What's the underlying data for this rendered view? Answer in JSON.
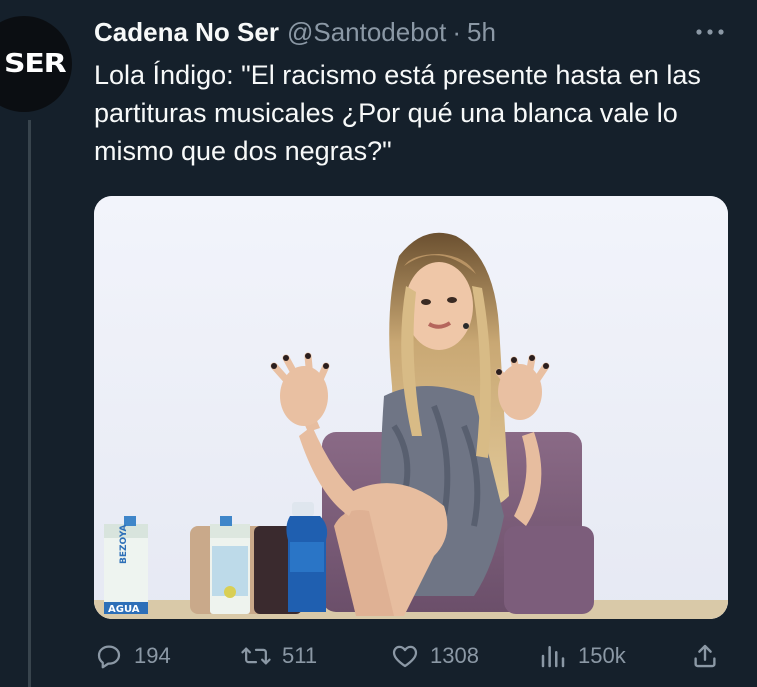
{
  "tweet": {
    "avatar_logo": "SER",
    "display_name": "Cadena No Ser",
    "handle": "@Santodebot",
    "separator": "·",
    "time": "5h",
    "text": "Lola Índigo: \"El racismo está presente hasta en las partituras musicales ¿Por qué una blanca vale lo mismo que dos negras?\"",
    "media": {
      "bottle_label_1": "BEZOYA",
      "bottle_label_2": "AGUA"
    },
    "actions": {
      "replies": "194",
      "retweets": "511",
      "likes": "1308",
      "views": "150k"
    }
  },
  "colors": {
    "background": "#15202b",
    "text": "#f7f9f9",
    "muted": "#8b98a5",
    "thread_line": "#38444d"
  },
  "icons": {
    "more": "more-horizontal-icon",
    "reply": "reply-icon",
    "retweet": "retweet-icon",
    "like": "heart-icon",
    "views": "analytics-icon",
    "share": "share-icon"
  }
}
